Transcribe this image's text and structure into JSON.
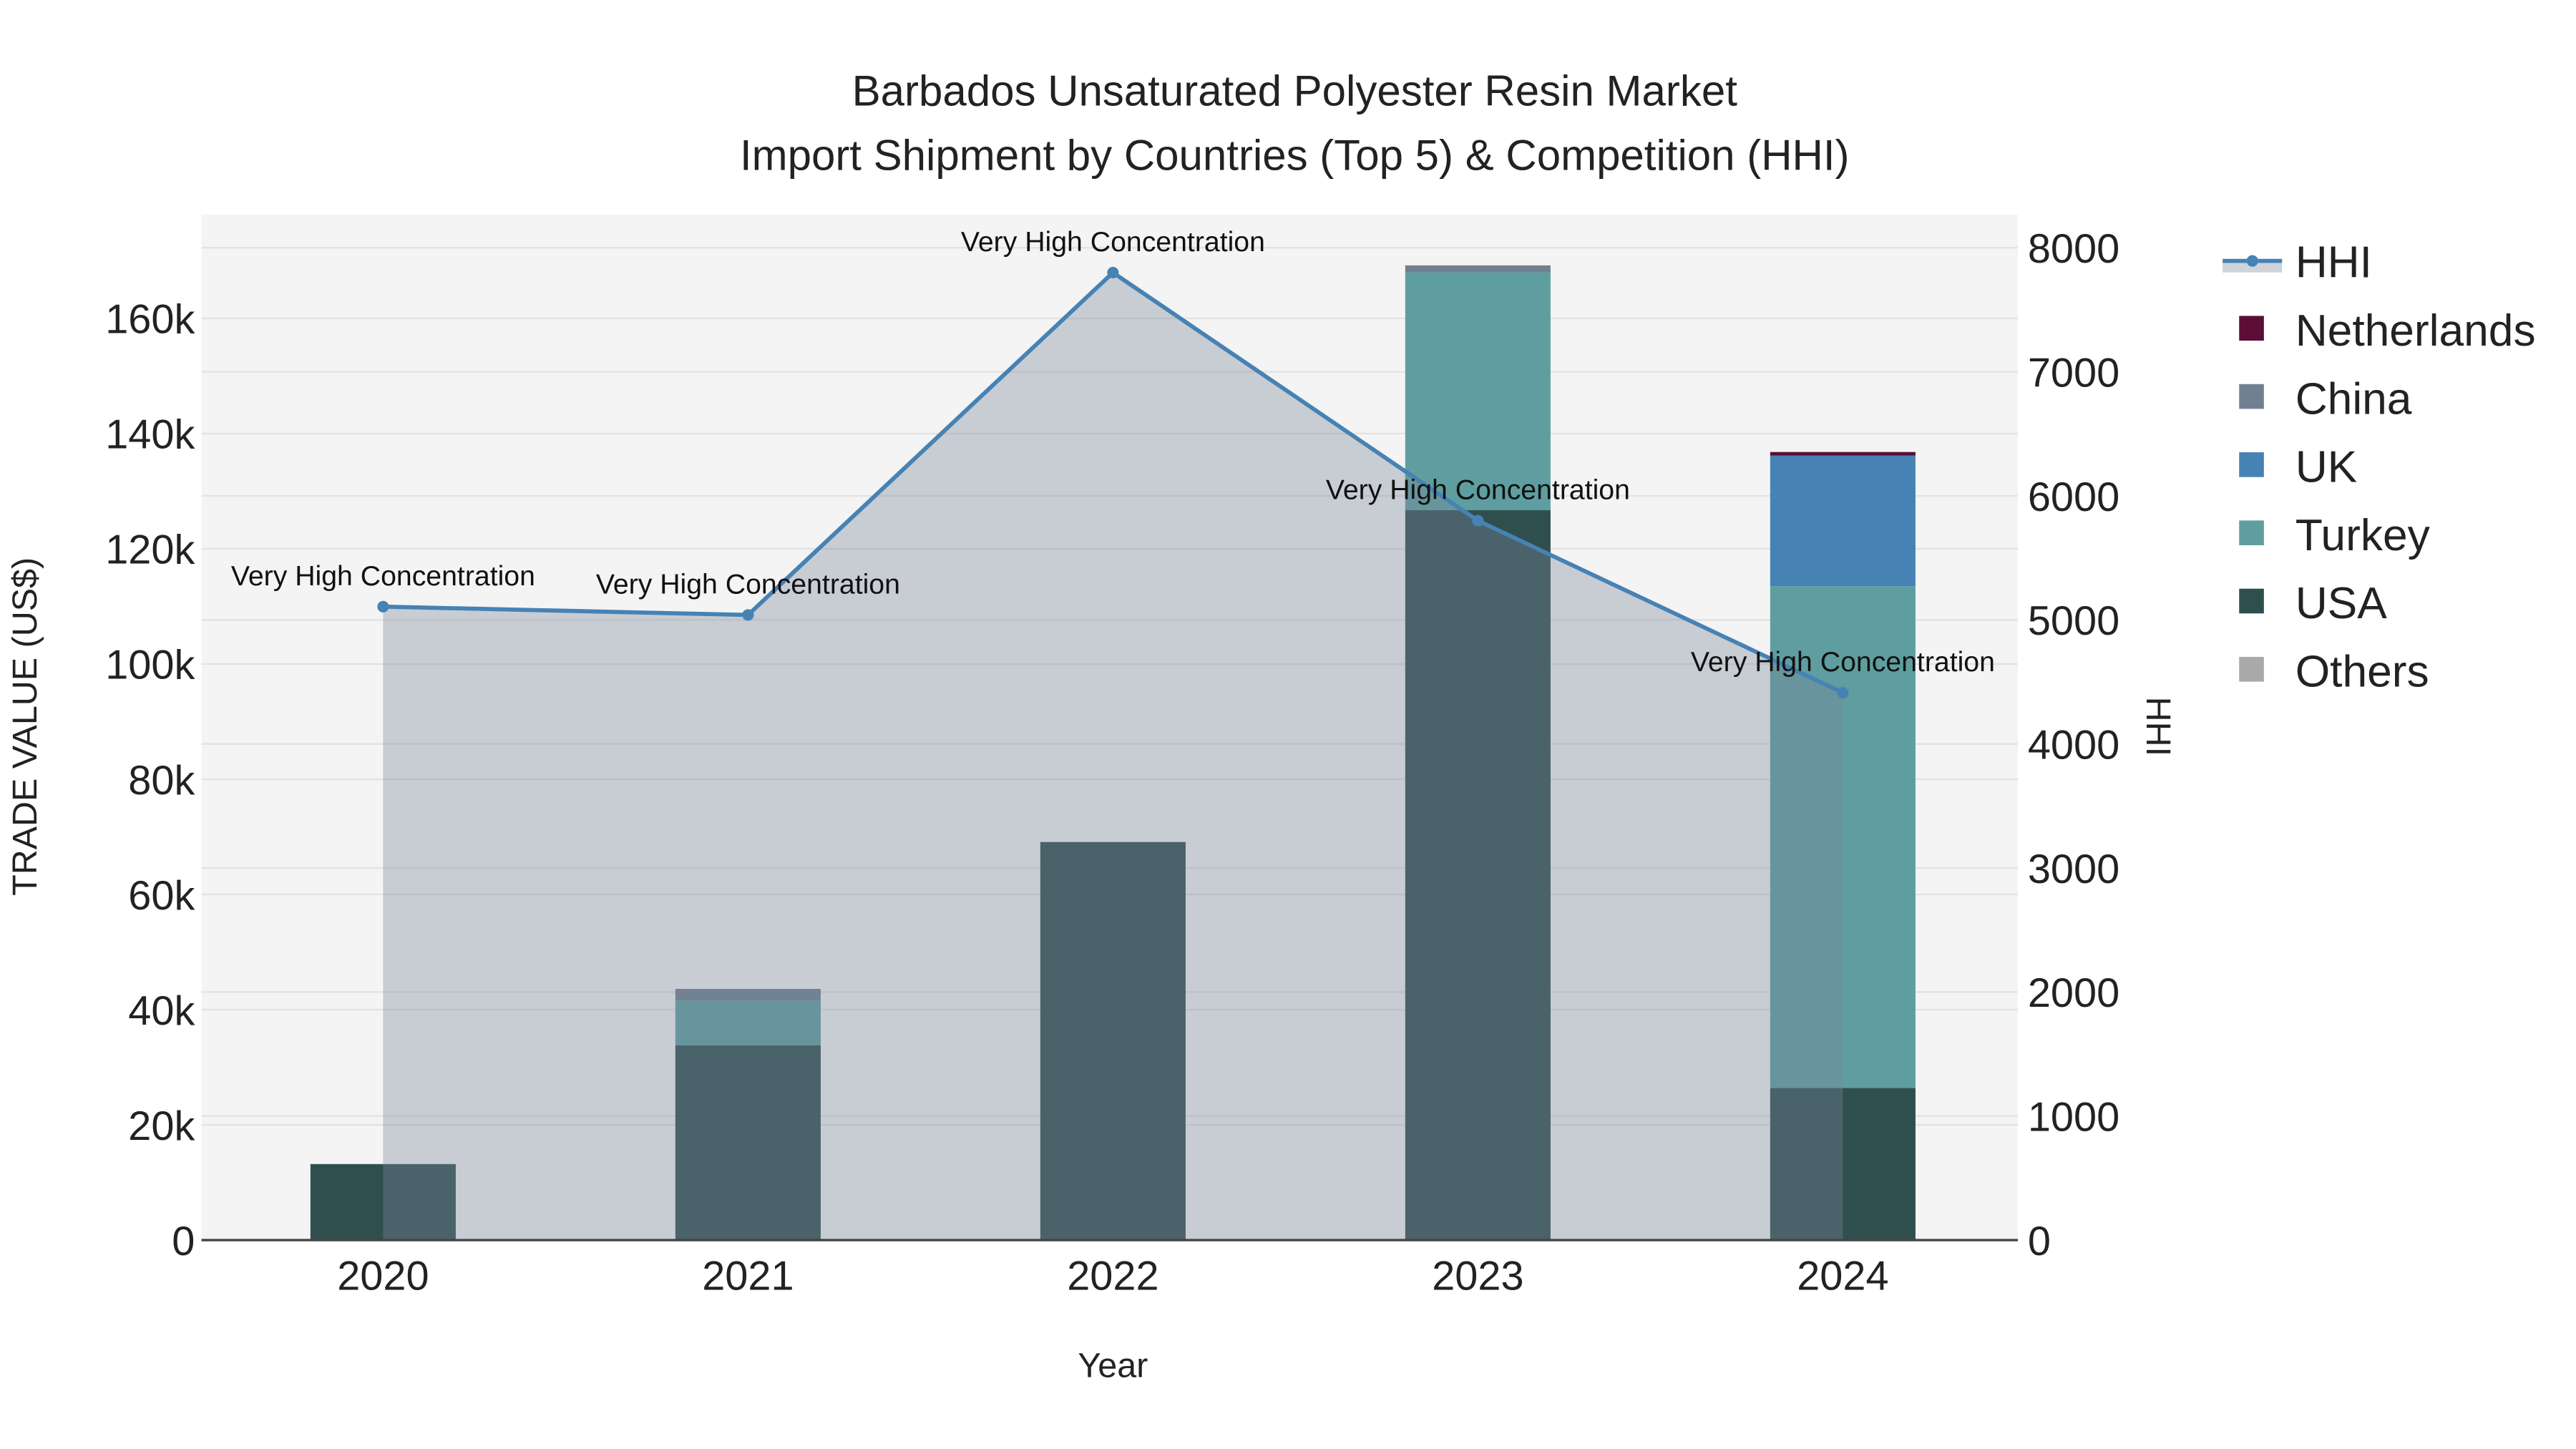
{
  "chart_data": {
    "type": "bar",
    "title": "Barbados Unsaturated Polyester Resin Market",
    "subtitle": "Import Shipment by Countries (Top 5) & Competition (HHI)",
    "xlabel": "Year",
    "ylabel": "TRADE VALUE (US$)",
    "y2label": "HHI",
    "categories": [
      "2020",
      "2021",
      "2022",
      "2023",
      "2024"
    ],
    "ylim": [
      0,
      178000
    ],
    "y2lim": [
      0,
      8267
    ],
    "yticks": [
      0,
      20000,
      40000,
      60000,
      80000,
      100000,
      120000,
      140000,
      160000
    ],
    "ytick_labels": [
      "0",
      "20k",
      "40k",
      "60k",
      "80k",
      "100k",
      "120k",
      "140k",
      "160k"
    ],
    "y2ticks": [
      0,
      1000,
      2000,
      3000,
      4000,
      5000,
      6000,
      7000,
      8000
    ],
    "y2tick_labels": [
      "0",
      "1000",
      "2000",
      "3000",
      "4000",
      "5000",
      "6000",
      "7000",
      "8000"
    ],
    "series": [
      {
        "name": "USA",
        "color": "#2f4f4f",
        "values": [
          13200,
          33800,
          69100,
          126700,
          26400
        ]
      },
      {
        "name": "Turkey",
        "color": "#5f9ea0",
        "values": [
          0,
          7800,
          0,
          41300,
          87100
        ]
      },
      {
        "name": "UK",
        "color": "#4682b4",
        "values": [
          0,
          0,
          0,
          0,
          22700
        ]
      },
      {
        "name": "China",
        "color": "#708090",
        "values": [
          0,
          2000,
          0,
          1200,
          0
        ]
      },
      {
        "name": "Netherlands",
        "color": "#5c0e36",
        "values": [
          0,
          0,
          0,
          0,
          600
        ]
      },
      {
        "name": "Others",
        "color": "#a9a9a9",
        "values": [
          0,
          0,
          0,
          0,
          0
        ]
      }
    ],
    "hhi": {
      "name": "HHI",
      "color": "#4682b4",
      "values": [
        5107,
        5040,
        7800,
        5800,
        4413
      ],
      "annotations": [
        "Very High Concentration",
        "Very High Concentration",
        "Very High Concentration",
        "Very High Concentration",
        "Very High Concentration"
      ]
    },
    "legend_order": [
      "HHI",
      "Netherlands",
      "China",
      "UK",
      "Turkey",
      "USA",
      "Others"
    ],
    "legend_position": "right",
    "grid": true
  }
}
